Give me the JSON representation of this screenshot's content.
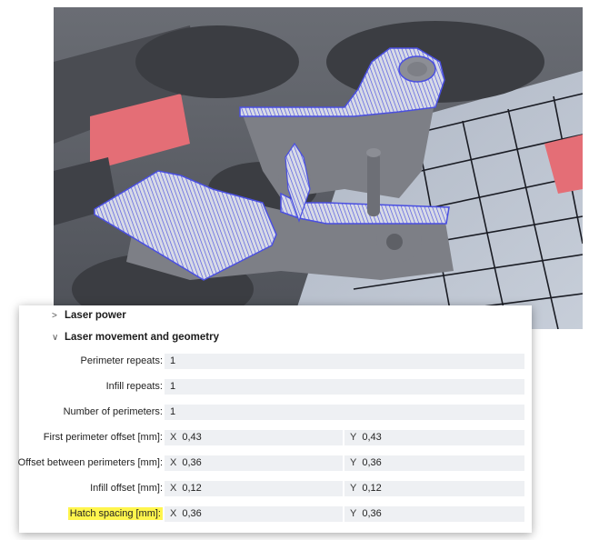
{
  "panel": {
    "sections": {
      "laser_power": "Laser power",
      "laser_movement": "Laser movement and geometry"
    },
    "rows": [
      {
        "label": "Perimeter repeats:",
        "value": "1"
      },
      {
        "label": "Infill repeats:",
        "value": "1"
      },
      {
        "label": "Number of perimeters:",
        "value": "1"
      },
      {
        "label": "First perimeter offset [mm]:",
        "x": "0,43",
        "y": "0,43"
      },
      {
        "label": "Offset between perimeters [mm]:",
        "x": "0,36",
        "y": "0,36"
      },
      {
        "label": "Infill offset [mm]:",
        "x": "0,12",
        "y": "0,12"
      },
      {
        "label": "Hatch spacing [mm]:",
        "x": "0,36",
        "y": "0,36"
      }
    ],
    "axis_x": "X",
    "axis_y": "Y",
    "highlight_color": "#fff54d"
  },
  "viewport": {
    "hatch_color": "#4a4fe0",
    "part_color": "#7d7f86",
    "grid_color": "#1a1c24",
    "accent_color": "#e46e76"
  }
}
